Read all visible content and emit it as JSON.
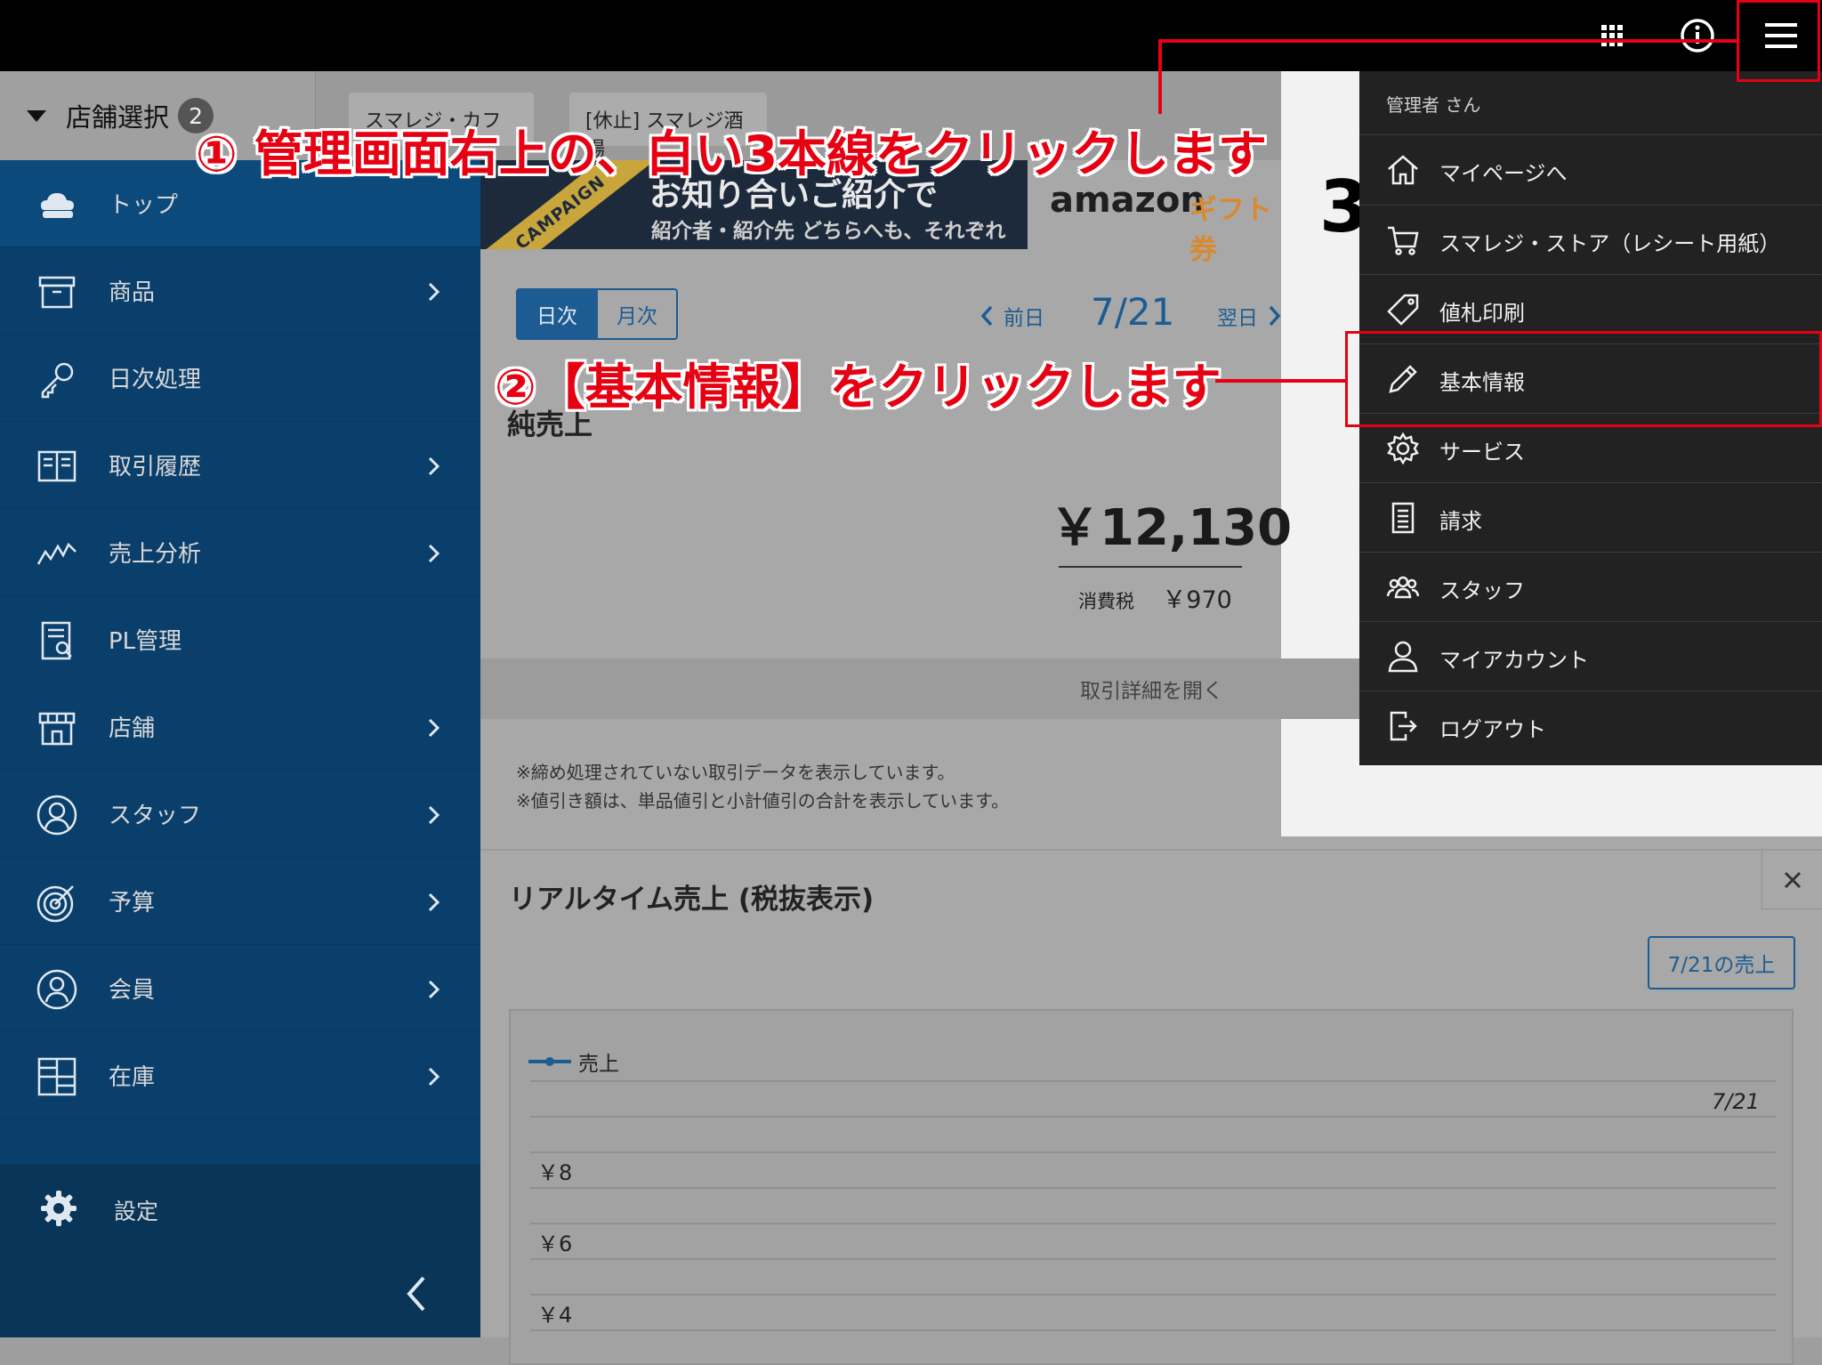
{
  "colors": {
    "sidebar": "#0b3f6b",
    "accent": "#1d5c92",
    "annotation": "#e60012",
    "menu_bg": "#222222"
  },
  "topbar": {
    "icons": [
      "apps-grid-icon",
      "info-icon",
      "hamburger-menu-icon"
    ]
  },
  "store_bar": {
    "label": "店舗選択",
    "count": "2",
    "tabs": [
      "スマレジ・カフェ",
      "[休止] スマレジ酒場"
    ]
  },
  "sidebar": {
    "items": [
      {
        "label": "トップ",
        "icon": "cloud-register-icon"
      },
      {
        "label": "商品",
        "icon": "box-icon"
      },
      {
        "label": "日次処理",
        "icon": "key-icon"
      },
      {
        "label": "取引履歴",
        "icon": "book-icon"
      },
      {
        "label": "売上分析",
        "icon": "line-trend-icon"
      },
      {
        "label": "PL管理",
        "icon": "report-icon"
      },
      {
        "label": "店舗",
        "icon": "store-icon"
      },
      {
        "label": "スタッフ",
        "icon": "person-circle-icon"
      },
      {
        "label": "予算",
        "icon": "target-icon"
      },
      {
        "label": "会員",
        "icon": "member-icon"
      },
      {
        "label": "在庫",
        "icon": "inventory-grid-icon"
      }
    ],
    "settings": "設定"
  },
  "banner": {
    "ribbon": "CAMPAIGN",
    "headline": "お知り合いご紹介で",
    "subline": "紹介者・紹介先 どちらへも、それぞれ",
    "amazon": "amazon",
    "gift": "ギフト券",
    "digit": "3"
  },
  "period": {
    "daily": "日次",
    "monthly": "月次",
    "prev": "前日",
    "date": "7/21",
    "next": "翌日"
  },
  "sales": {
    "label": "純売上",
    "amount": "￥12,130",
    "tax_label": "消費税",
    "tax_value": "￥970",
    "details_toggle": "取引詳細を開く",
    "notes": [
      "※締め処理されていない取引データを表示しています。",
      "※値引き額は、単品値引と小計値引の合計を表示しています。"
    ]
  },
  "realtime": {
    "title": "リアルタイム売上 (税抜表示)",
    "date_button": "7/21の売上",
    "legend": "売上",
    "x_label": "7/21",
    "y_ticks": [
      "￥8",
      "￥6",
      "￥4"
    ]
  },
  "menu": {
    "user": "管理者 さん",
    "items": [
      {
        "label": "マイページへ",
        "icon": "home-icon"
      },
      {
        "label": "スマレジ・ストア（レシート用紙）",
        "icon": "cart-icon"
      },
      {
        "label": "値札印刷",
        "icon": "tag-icon"
      },
      {
        "label": "基本情報",
        "icon": "pencil-icon"
      },
      {
        "label": "サービス",
        "icon": "gear-icon"
      },
      {
        "label": "請求",
        "icon": "document-icon"
      },
      {
        "label": "スタッフ",
        "icon": "group-icon"
      },
      {
        "label": "マイアカウント",
        "icon": "person-icon"
      },
      {
        "label": "ログアウト",
        "icon": "logout-icon"
      }
    ]
  },
  "annotations": {
    "step1": "① 管理画面右上の、白い3本線をクリックします",
    "step2": "②【基本情報】をクリックします"
  }
}
